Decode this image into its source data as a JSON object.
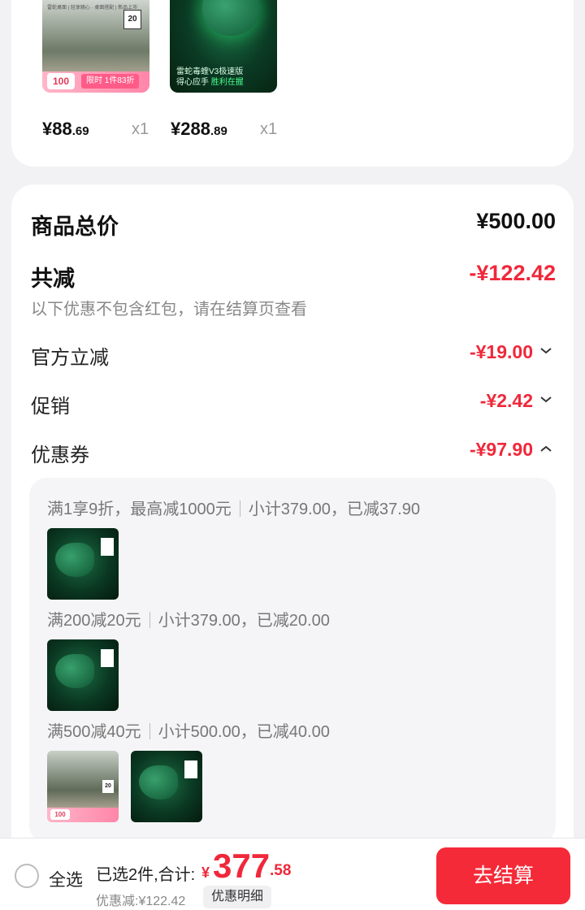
{
  "cart_items": [
    {
      "price_int": "¥88",
      "price_dec": ".69",
      "qty": "x1",
      "thumb_badge": "100",
      "thumb_tag": "限时 1件83折",
      "thumb_num": "20",
      "thumb_header": "雷蛇桌面 | 轻享随心 · 桌面搭配 | 新品上市"
    },
    {
      "price_int": "¥288",
      "price_dec": ".89",
      "qty": "x1",
      "thumb_caption_1": "雷蛇毒蝰V3极速版",
      "thumb_caption_2a": "得心应手 ",
      "thumb_caption_2b": "胜利在握"
    }
  ],
  "summary": {
    "total_label": "商品总价",
    "total_value": "¥500.00",
    "reduce_label": "共减",
    "reduce_value": "-¥122.42",
    "hint": "以下优惠不包含红包，请在结算页查看",
    "lines": [
      {
        "label": "官方立减",
        "value": "-¥19.00",
        "icon": "chevron-down-icon"
      },
      {
        "label": "促销",
        "value": "-¥2.42",
        "icon": "chevron-down-icon"
      },
      {
        "label": "优惠券",
        "value": "-¥97.90",
        "icon": "chevron-up-icon"
      }
    ]
  },
  "coupons": [
    {
      "rule": "满1享9折，最高减1000元",
      "detail": "小计379.00，已减37.90"
    },
    {
      "rule": "满200减20元",
      "detail": "小计379.00，已减20.00"
    },
    {
      "rule": "满500减40元",
      "detail": "小计500.00，已减40.00"
    }
  ],
  "bottom_bar": {
    "select_all": "全选",
    "selected_text": "已选2件,合计:",
    "currency": "¥",
    "total_int": "377",
    "total_dec": ".58",
    "discount_text": "优惠减:¥122.42",
    "detail_button": "优惠明细",
    "checkout_button": "去结算"
  },
  "colors": {
    "accent_red": "#f0283a",
    "checkout_bg": "#f52a38",
    "page_bg": "#f2f2f4"
  }
}
